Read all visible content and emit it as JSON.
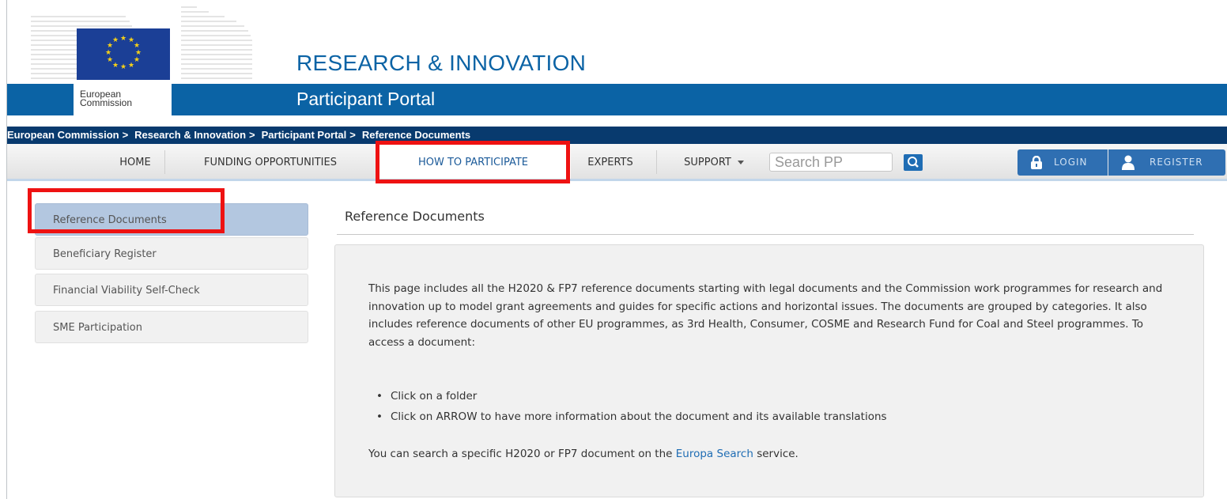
{
  "header": {
    "logo_line1": "European",
    "logo_line2": "Commission",
    "site_title": "RESEARCH & INNOVATION",
    "portal_title": "Participant Portal"
  },
  "breadcrumb": [
    "European Commission",
    "Research & Innovation",
    "Participant Portal",
    "Reference Documents"
  ],
  "breadcrumb_sep": ">",
  "nav": {
    "home": "HOME",
    "funding": "FUNDING OPPORTUNITIES",
    "how_to_participate": "HOW TO PARTICIPATE",
    "experts": "EXPERTS",
    "support": "SUPPORT",
    "search_placeholder": "Search PP",
    "login": "LOGIN",
    "register": "REGISTER"
  },
  "sidebar": {
    "items": [
      {
        "label": "Reference Documents"
      },
      {
        "label": "Beneficiary Register"
      },
      {
        "label": "Financial Viability Self-Check"
      },
      {
        "label": "SME Participation"
      }
    ]
  },
  "content": {
    "title": "Reference Documents",
    "paragraph": "This page includes all the H2020 & FP7 reference documents starting with legal documents and the Commission work programmes for research and innovation up to model grant agreements and guides for specific actions and horizontal issues. The documents are grouped by categories. It also includes reference documents of other EU programmes, as 3rd Health, Consumer, COSME and Research Fund for Coal and Steel programmes. To access a document:",
    "bullets": [
      "Click on a folder",
      "Click on ARROW to have more information about the document and its available translations"
    ],
    "search_before": "You can search a specific H2020 or FP7 document on the",
    "search_link": "Europa Search",
    "search_after": "service."
  },
  "colors": {
    "brand_blue": "#0b63a5",
    "breadcrumb_bg": "#083a6e",
    "highlight_red": "#ee1212"
  }
}
